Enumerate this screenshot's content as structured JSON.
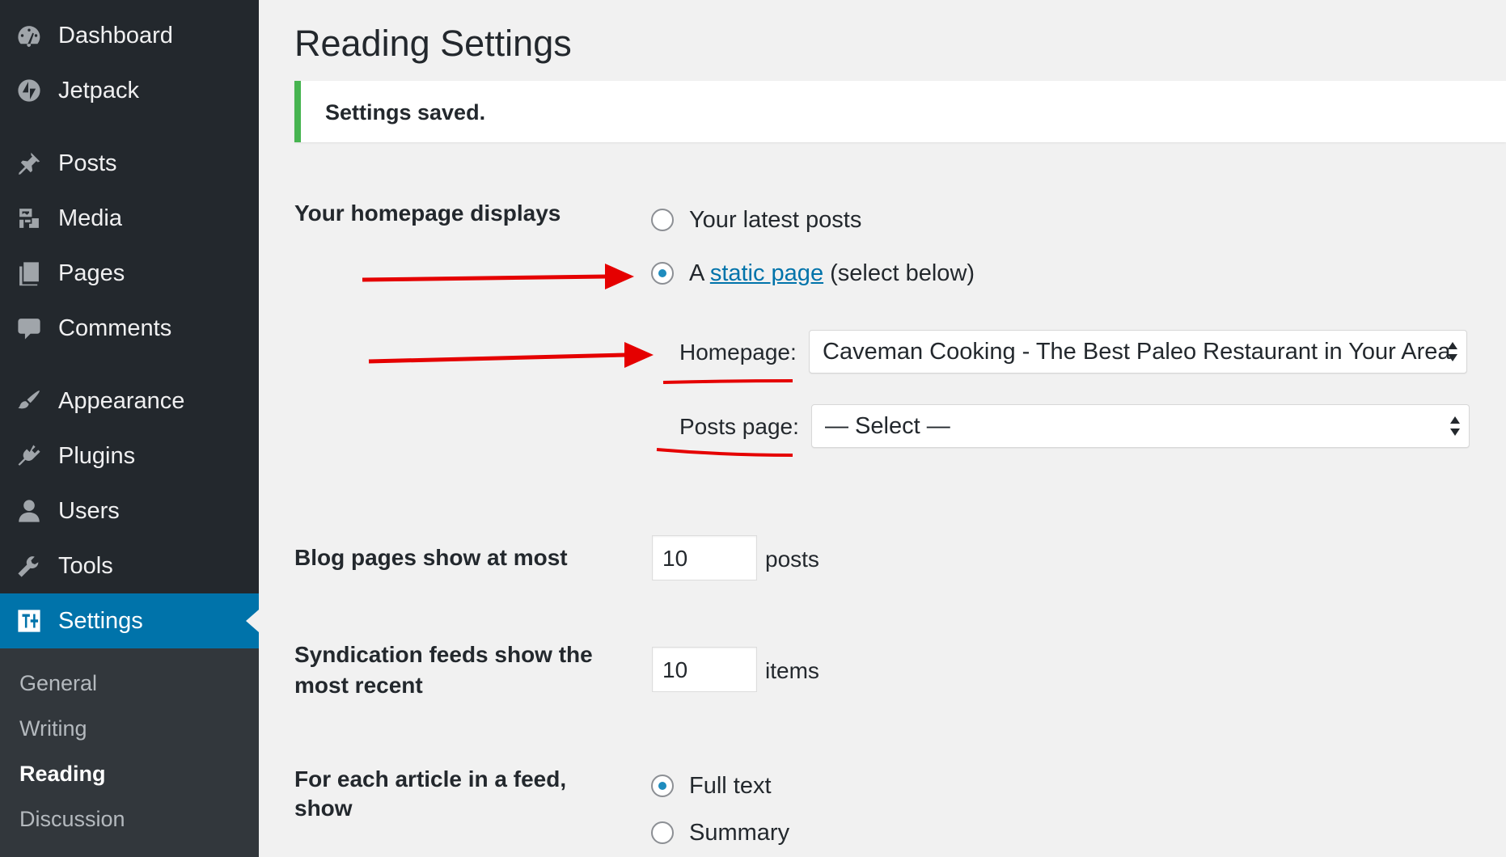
{
  "sidebar": {
    "items": [
      {
        "label": "Dashboard",
        "icon": "dashboard-icon"
      },
      {
        "label": "Jetpack",
        "icon": "jetpack-icon"
      },
      {
        "label": "Posts",
        "icon": "pin-icon"
      },
      {
        "label": "Media",
        "icon": "media-icon"
      },
      {
        "label": "Pages",
        "icon": "pages-icon"
      },
      {
        "label": "Comments",
        "icon": "comment-icon"
      },
      {
        "label": "Appearance",
        "icon": "paintbrush-icon"
      },
      {
        "label": "Plugins",
        "icon": "plugin-icon"
      },
      {
        "label": "Users",
        "icon": "user-icon"
      },
      {
        "label": "Tools",
        "icon": "wrench-icon"
      },
      {
        "label": "Settings",
        "icon": "settings-icon",
        "active": true
      }
    ],
    "submenu": [
      {
        "label": "General"
      },
      {
        "label": "Writing"
      },
      {
        "label": "Reading",
        "current": true
      },
      {
        "label": "Discussion"
      }
    ],
    "colors": {
      "background": "#23282d",
      "active": "#0073aa",
      "submenu": "#32373c"
    }
  },
  "main": {
    "title": "Reading Settings",
    "notice": "Settings saved.",
    "homepage_displays": {
      "label": "Your homepage displays",
      "option_latest": "Your latest posts",
      "option_static_prefix": "A",
      "option_static_link": "static page",
      "option_static_suffix": "(select below)",
      "selected": "static page",
      "homepage_label": "Homepage:",
      "homepage_value": "Caveman Cooking - The Best Paleo Restaurant in Your Area",
      "posts_page_label": "Posts page:",
      "posts_page_value": "— Select —"
    },
    "blog_pages": {
      "label": "Blog pages show at most",
      "value": "10",
      "suffix": "posts"
    },
    "syndication": {
      "label_line1": "Syndication feeds show the",
      "label_line2": "most recent",
      "value": "10",
      "suffix": "items"
    },
    "feed_article": {
      "label_line1": "For each article in a feed,",
      "label_line2": "show",
      "option_full": "Full text",
      "option_summary": "Summary",
      "selected": "Full text"
    },
    "colors": {
      "notice_border": "#46b450",
      "link": "#0073aa",
      "annotation": "#e50000"
    }
  }
}
